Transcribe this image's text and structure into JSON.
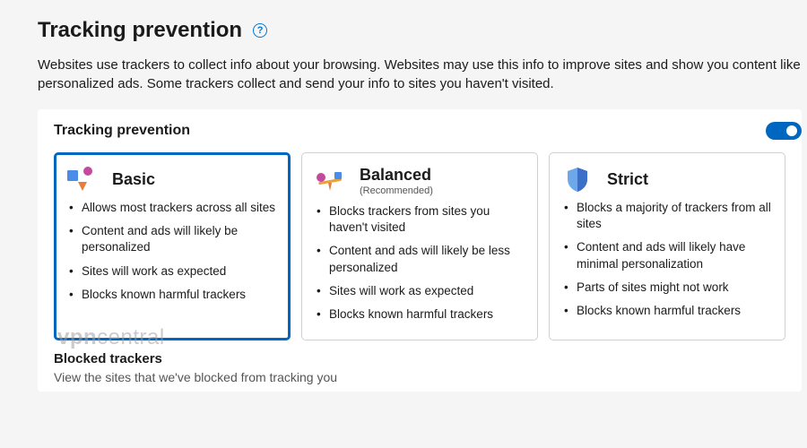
{
  "header": {
    "title": "Tracking prevention",
    "help_glyph": "?",
    "description": "Websites use trackers to collect info about your browsing. Websites may use this info to improve sites and show you content like personalized ads. Some trackers collect and send your info to sites you haven't visited."
  },
  "panel": {
    "title": "Tracking prevention",
    "toggle_on": true
  },
  "cards": [
    {
      "id": "basic",
      "title": "Basic",
      "subtitle": "",
      "selected": true,
      "bullets": [
        "Allows most trackers across all sites",
        "Content and ads will likely be personalized",
        "Sites will work as expected",
        "Blocks known harmful trackers"
      ]
    },
    {
      "id": "balanced",
      "title": "Balanced",
      "subtitle": "(Recommended)",
      "selected": false,
      "bullets": [
        "Blocks trackers from sites you haven't visited",
        "Content and ads will likely be less personalized",
        "Sites will work as expected",
        "Blocks known harmful trackers"
      ]
    },
    {
      "id": "strict",
      "title": "Strict",
      "subtitle": "",
      "selected": false,
      "bullets": [
        "Blocks a majority of trackers from all sites",
        "Content and ads will likely have minimal personalization",
        "Parts of sites might not work",
        "Blocks known harmful trackers"
      ]
    }
  ],
  "blocked": {
    "title": "Blocked trackers",
    "desc": "View the sites that we've blocked from tracking you"
  },
  "watermark": {
    "left": "vpn",
    "right": "central"
  }
}
